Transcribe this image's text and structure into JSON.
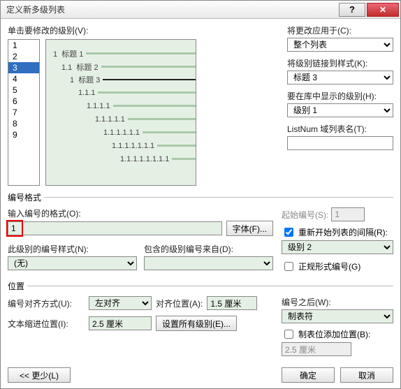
{
  "title": "定义新多级列表",
  "click_level_label": "单击要修改的级别(V):",
  "levels": [
    "1",
    "2",
    "3",
    "4",
    "5",
    "6",
    "7",
    "8",
    "9"
  ],
  "selected_level": "3",
  "preview": {
    "rows": [
      {
        "num": "1",
        "label": "标题 1"
      },
      {
        "num": "1.1",
        "label": "标题 2"
      },
      {
        "num": "1",
        "label": "标题 3",
        "dark": true
      },
      {
        "num": "1.1.1",
        "label": ""
      },
      {
        "num": "1.1.1.1",
        "label": ""
      },
      {
        "num": "1.1.1.1.1",
        "label": ""
      },
      {
        "num": "1.1.1.1.1.1",
        "label": ""
      },
      {
        "num": "1.1.1.1.1.1.1",
        "label": ""
      },
      {
        "num": "1.1.1.1.1.1.1.1",
        "label": ""
      }
    ]
  },
  "apply_to_label": "将更改应用于(C):",
  "apply_to_value": "整个列表",
  "link_style_label": "将级别链接到样式(K):",
  "link_style_value": "标题 3",
  "gallery_level_label": "要在库中显示的级别(H):",
  "gallery_level_value": "级别 1",
  "listnum_label": "ListNum 域列表名(T):",
  "listnum_value": "",
  "numfmt_legend": "编号格式",
  "enter_fmt_label": "输入编号的格式(O):",
  "enter_fmt_value": "1",
  "font_btn": "字体(F)...",
  "start_label": "起始编号(S):",
  "start_value": "1",
  "restart_label": "重新开始列表的间隔(R):",
  "restart_checked": true,
  "restart_level_value": "级别 2",
  "legal_label": "正规形式编号(G)",
  "legal_checked": false,
  "level_numstyle_label": "此级别的编号样式(N):",
  "level_numstyle_value": "(无)",
  "include_from_label": "包含的级别编号来自(D):",
  "include_from_value": "",
  "pos_legend": "位置",
  "align_label": "编号对齐方式(U):",
  "align_value": "左对齐",
  "align_at_label": "对齐位置(A):",
  "align_at_value": "1.5 厘米",
  "follow_label": "编号之后(W):",
  "follow_value": "制表符",
  "indent_label": "文本缩进位置(I):",
  "indent_value": "2.5 厘米",
  "set_all_btn": "设置所有级别(E)...",
  "tab_add_label": "制表位添加位置(B):",
  "tab_add_checked": false,
  "tab_add_value": "2.5 厘米",
  "less_btn": "<< 更少(L)",
  "ok_btn": "确定",
  "cancel_btn": "取消"
}
